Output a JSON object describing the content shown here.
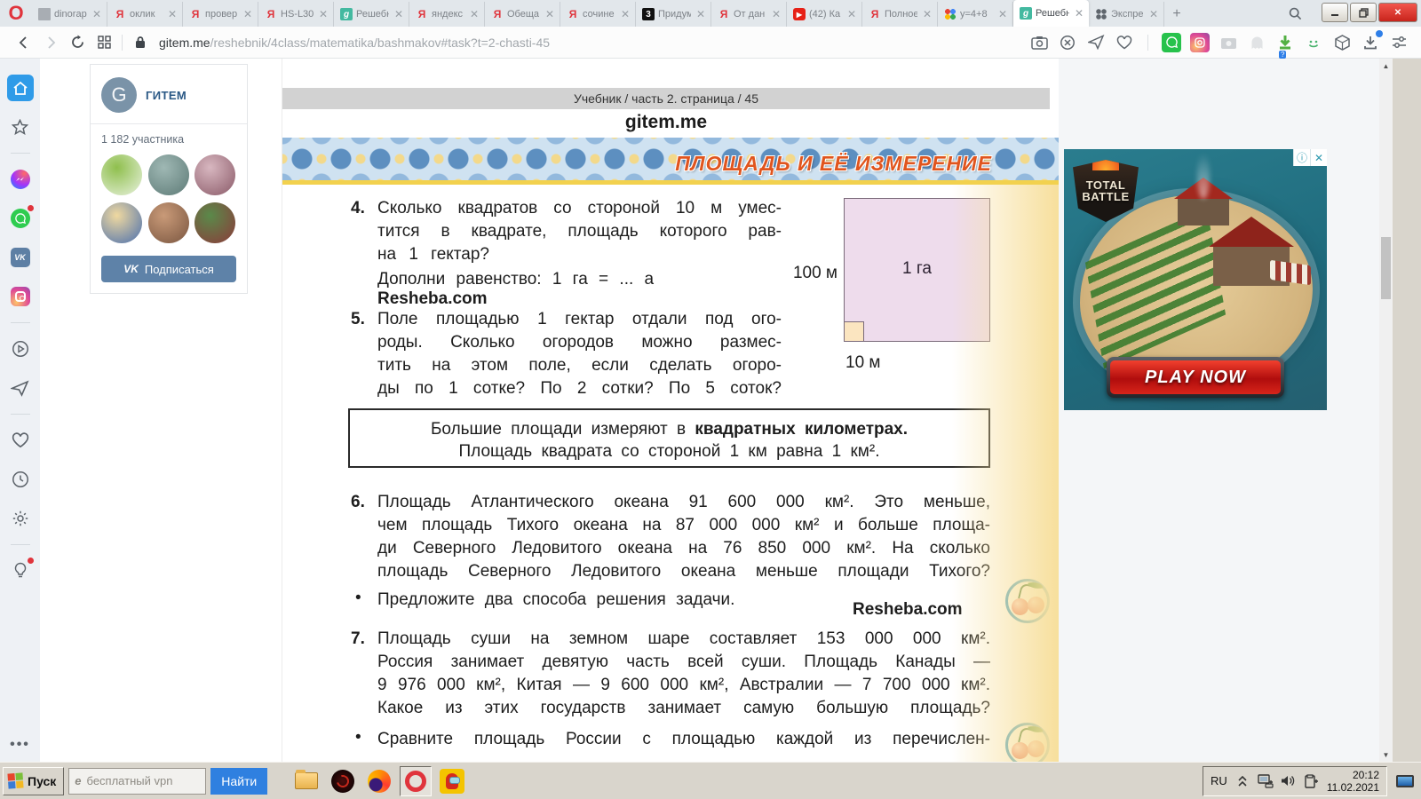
{
  "window": {
    "minimize_label": "–",
    "restore_label": "❐",
    "close_label": "✕"
  },
  "tabs": [
    {
      "label": "dinorap",
      "icon": "document",
      "active": false
    },
    {
      "label": "оклик",
      "icon": "yandex",
      "active": false
    },
    {
      "label": "провер",
      "icon": "yandex",
      "active": false
    },
    {
      "label": "HS-L30",
      "icon": "yandex",
      "active": false
    },
    {
      "label": "Решебн",
      "icon": "resheba",
      "active": false
    },
    {
      "label": "яндекс",
      "icon": "yandex",
      "active": false
    },
    {
      "label": "Обеща",
      "icon": "yandex",
      "active": false
    },
    {
      "label": "сочине",
      "icon": "yandex",
      "active": false
    },
    {
      "label": "Придум",
      "icon": "black3",
      "active": false
    },
    {
      "label": "От дан",
      "icon": "yandex",
      "active": false
    },
    {
      "label": "(42) Ка",
      "icon": "youtube",
      "active": false
    },
    {
      "label": "Полное",
      "icon": "yandex",
      "active": false
    },
    {
      "label": "y=4+8",
      "icon": "dots",
      "active": false
    },
    {
      "label": "Решебн",
      "icon": "resheba",
      "active": true
    },
    {
      "label": "Экспре",
      "icon": "grid",
      "active": false
    }
  ],
  "tab_glyphs": {
    "yandex": "Я",
    "resheba": "g",
    "black3": "3",
    "youtube": "▶",
    "document": "",
    "dots": "",
    "grid": ""
  },
  "toolbar": {
    "url_host": "gitem.me",
    "url_path": "/reshebnik/4class/matematika/bashmakov#task?t=2-chasti-45",
    "new_tab": "+"
  },
  "vk_widget": {
    "avatar_letter": "G",
    "title": "ГИТЕМ",
    "members": "1 182 участника",
    "vk_logo": "VK",
    "subscribe_label": "Подписаться",
    "avatars": [
      [
        "#8fbf4d",
        "#e9f2df"
      ],
      [
        "#9fb8b4",
        "#5d7a76"
      ],
      [
        "#d8b7c0",
        "#8a5a68"
      ],
      [
        "#f0d9a0",
        "#4a6fae"
      ],
      [
        "#c99a78",
        "#7a5640"
      ],
      [
        "#5a8a4a",
        "#8c3a3a"
      ]
    ]
  },
  "page": {
    "breadcrumb": "Учебник / часть 2. страница / 45",
    "site_title": "gitem.me",
    "banner_title": "ПЛОЩАДЬ И ЕЁ ИЗМЕРЕНИЕ",
    "problem4": {
      "num": "4.",
      "lines": [
        "Сколько квадратов со стороной 10 м умес-",
        "тится в квадрате, площадь которого рав-",
        "на 1 гектар?"
      ],
      "extra": "Дополни равенство:  1 га  =  ... а",
      "watermark": "Resheba.com"
    },
    "diagram": {
      "area_label": "1 га",
      "side_label": "100 м",
      "unit_label": "10 м"
    },
    "problem5": {
      "num": "5.",
      "lines": [
        "Поле площадью 1 гектар отдали под ого-",
        "роды. Сколько огородов можно размес-",
        "тить на этом поле, если сделать огоро-",
        "ды по 1 сотке? По 2 сотки? По 5 соток?"
      ]
    },
    "note": {
      "line1_normal": "Большие площади измеряют в ",
      "line1_bold": "квадратных километрах.",
      "line2": "Площадь квадрата со стороной 1 км равна 1 км²."
    },
    "problem6": {
      "num": "6.",
      "lines": [
        "Площадь Атлантического океана 91 600 000 км². Это меньше,",
        "чем площадь Тихого океана на 87 000 000 км² и больше площа-",
        "ди Северного Ледовитого океана на 76 850 000 км². На сколько",
        "площадь Северного Ледовитого океана меньше площади Тихого?"
      ]
    },
    "bullet6": {
      "marker": "•",
      "text": "Предложите два способа решения задачи.",
      "watermark": "Resheba.com"
    },
    "problem7": {
      "num": "7.",
      "lines": [
        "Площадь суши на земном шаре составляет 153 000 000 км².",
        "Россия занимает девятую часть всей суши. Площадь Канады —",
        "9 976 000 км², Китая — 9 600 000 км², Австралии — 7 700 000 км².",
        "Какое из этих государств занимает самую большую площадь?"
      ]
    },
    "bullet7": {
      "marker": "•",
      "text": "Сравните площадь России с площадью каждой из перечислен-"
    }
  },
  "ad": {
    "logo_line1": "TOTAL",
    "logo_line2": "BATTLE",
    "cta": "PLAY NOW",
    "info": "ⓘ",
    "close": "✕"
  },
  "taskbar": {
    "start": "Пуск",
    "search_placeholder": "бесплатный vpn",
    "find_label": "Найти",
    "lang": "RU",
    "time": "20:12",
    "date": "11.02.2021"
  },
  "colors": {
    "accent_red": "#e0343c",
    "vk_blue": "#5e82a8",
    "banner_orange": "#e0551e",
    "find_blue": "#2f80e0"
  }
}
